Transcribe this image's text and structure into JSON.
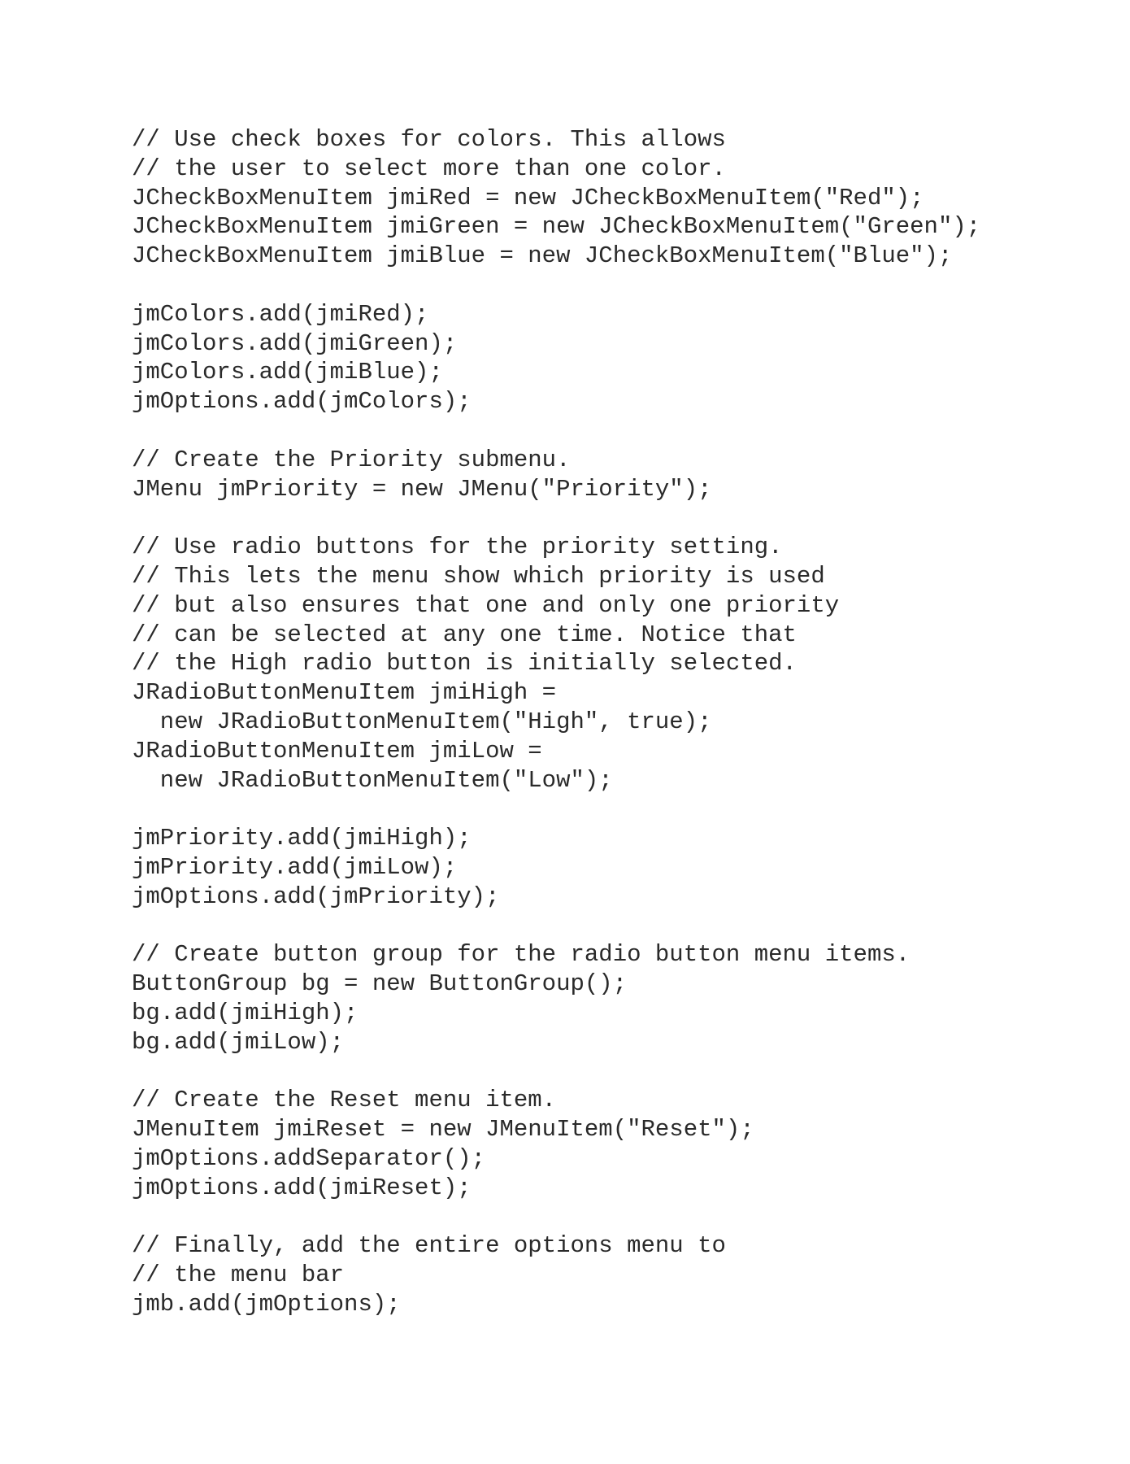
{
  "code": {
    "lines": [
      "// Use check boxes for colors. This allows",
      "// the user to select more than one color.",
      "JCheckBoxMenuItem jmiRed = new JCheckBoxMenuItem(\"Red\");",
      "JCheckBoxMenuItem jmiGreen = new JCheckBoxMenuItem(\"Green\");",
      "JCheckBoxMenuItem jmiBlue = new JCheckBoxMenuItem(\"Blue\");",
      "",
      "jmColors.add(jmiRed);",
      "jmColors.add(jmiGreen);",
      "jmColors.add(jmiBlue);",
      "jmOptions.add(jmColors);",
      "",
      "// Create the Priority submenu.",
      "JMenu jmPriority = new JMenu(\"Priority\");",
      "",
      "// Use radio buttons for the priority setting.",
      "// This lets the menu show which priority is used",
      "// but also ensures that one and only one priority",
      "// can be selected at any one time. Notice that",
      "// the High radio button is initially selected.",
      "JRadioButtonMenuItem jmiHigh =",
      "  new JRadioButtonMenuItem(\"High\", true);",
      "JRadioButtonMenuItem jmiLow =",
      "  new JRadioButtonMenuItem(\"Low\");",
      "",
      "jmPriority.add(jmiHigh);",
      "jmPriority.add(jmiLow);",
      "jmOptions.add(jmPriority);",
      "",
      "// Create button group for the radio button menu items.",
      "ButtonGroup bg = new ButtonGroup();",
      "bg.add(jmiHigh);",
      "bg.add(jmiLow);",
      "",
      "// Create the Reset menu item.",
      "JMenuItem jmiReset = new JMenuItem(\"Reset\");",
      "jmOptions.addSeparator();",
      "jmOptions.add(jmiReset);",
      "",
      "// Finally, add the entire options menu to",
      "// the menu bar",
      "jmb.add(jmOptions);"
    ]
  }
}
